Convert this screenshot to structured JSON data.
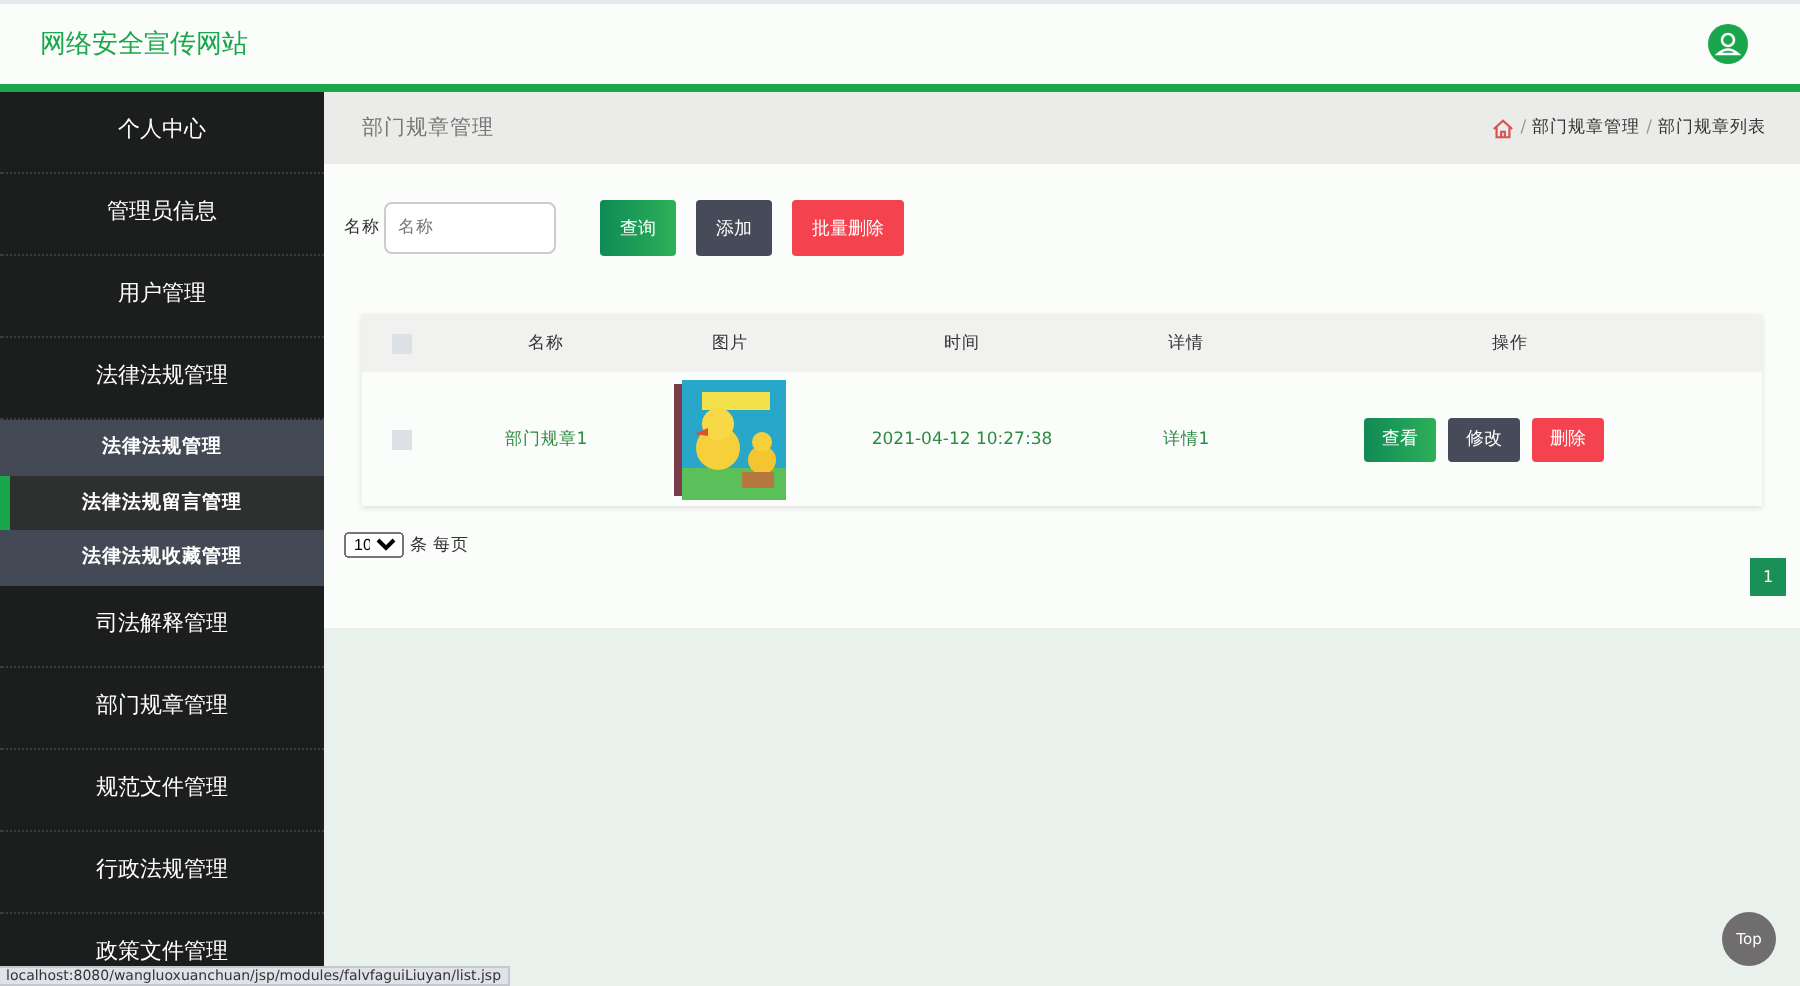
{
  "header": {
    "title": "网络安全宣传网站"
  },
  "sidebar": {
    "items": [
      {
        "label": "个人中心"
      },
      {
        "label": "管理员信息"
      },
      {
        "label": "用户管理"
      },
      {
        "label": "法律法规管理",
        "children": [
          {
            "label": "法律法规管理",
            "selected": false
          },
          {
            "label": "法律法规留言管理",
            "selected": true
          },
          {
            "label": "法律法规收藏管理",
            "selected": false
          }
        ]
      },
      {
        "label": "司法解释管理"
      },
      {
        "label": "部门规章管理"
      },
      {
        "label": "规范文件管理"
      },
      {
        "label": "行政法规管理"
      },
      {
        "label": "政策文件管理"
      }
    ]
  },
  "page_title": "部门规章管理",
  "breadcrumb": {
    "separator": "/",
    "items": [
      "部门规章管理",
      "部门规章列表"
    ]
  },
  "search": {
    "label": "名称",
    "placeholder": "名称"
  },
  "buttons": [
    {
      "label": "查询",
      "kind": "primary"
    },
    {
      "label": "添加",
      "kind": "dark"
    },
    {
      "label": "批量删除",
      "kind": "danger"
    }
  ],
  "table": {
    "select_all": {
      "checked": false
    },
    "columns": [
      "名称",
      "图片",
      "时间",
      "详情",
      "操作"
    ],
    "rows": [
      {
        "checked": false,
        "name": "部门规章1",
        "time": "2021-04-12 10:27:38",
        "detail": "详情1",
        "actions": [
          {
            "label": "查看",
            "kind": "primary"
          },
          {
            "label": "修改",
            "kind": "dark"
          },
          {
            "label": "删除",
            "kind": "danger"
          }
        ]
      }
    ]
  },
  "page_size": {
    "value": "10",
    "suffix": "条 每页"
  },
  "pagination": [
    {
      "label": "1",
      "selected": true
    }
  ],
  "top_button": "Top",
  "status_bar": "localhost:8080/wangluoxuanchuan/jsp/modules/falvfaguiLiuyan/list.jsp"
}
